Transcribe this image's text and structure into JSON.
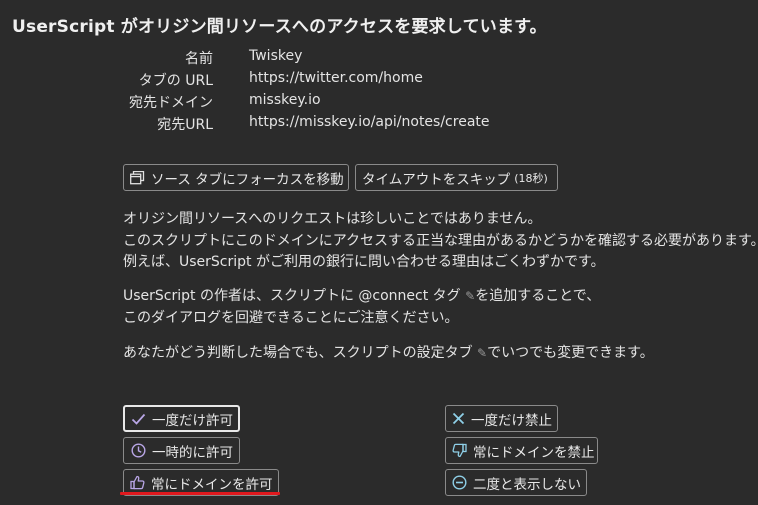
{
  "title": "UserScript がオリジン間リソースへのアクセスを要求しています。",
  "info": {
    "name_label": "名前",
    "name_value": "Twiskey",
    "tab_url_label": "タブの URL",
    "tab_url_value": "https://twitter.com/home",
    "dest_domain_label": "宛先ドメイン",
    "dest_domain_value": "misskey.io",
    "dest_url_label": "宛先URL",
    "dest_url_value": "https://misskey.io/api/notes/create"
  },
  "toolbar": {
    "focus_source_tab": "ソース タブにフォーカスを移動",
    "skip_timeout": "タイムアウトをスキップ",
    "skip_timeout_countdown": "(18秒)"
  },
  "message": {
    "line1": "オリジン間リソースへのリクエストは珍しいことではありません。",
    "line2": "このスクリプトにこのドメインにアクセスする正当な理由があるかどうかを確認する必要があります。",
    "line3": "例えば、UserScript がご利用の銀行に問い合わせる理由はごくわずかです。",
    "line4": "UserScript の作者は、スクリプトに @connect タグ",
    "line4_end": "を追加することで、",
    "line5": "このダイアログを回避できることにご注意ください。",
    "line6": "あなたがどう判断した場合でも、スクリプトの設定タブ",
    "line6_end": "でいつでも変更できます。"
  },
  "actions": {
    "allow_once": "一度だけ許可",
    "allow_temporarily": "一時的に許可",
    "allow_domain_always": "常にドメインを許可",
    "deny_once": "一度だけ禁止",
    "deny_domain_always": "常にドメインを禁止",
    "never_ask_again": "二度と表示しない"
  },
  "colors": {
    "background": "#2b2b2b",
    "text": "#e4e4e4",
    "border": "#8a8a8a",
    "allow_icon": "#b9a6e6",
    "deny_icon": "#8fd0e8",
    "highlight": "#e0191e"
  },
  "icons": {
    "focus_tab": "window-icon",
    "allow_once": "check-icon",
    "allow_temporarily": "clock-icon",
    "allow_domain_always": "thumbs-up-icon",
    "deny_once": "x-icon",
    "deny_domain_always": "thumbs-down-icon",
    "never_ask_again": "minus-circle-icon",
    "edit": "pencil-icon"
  }
}
